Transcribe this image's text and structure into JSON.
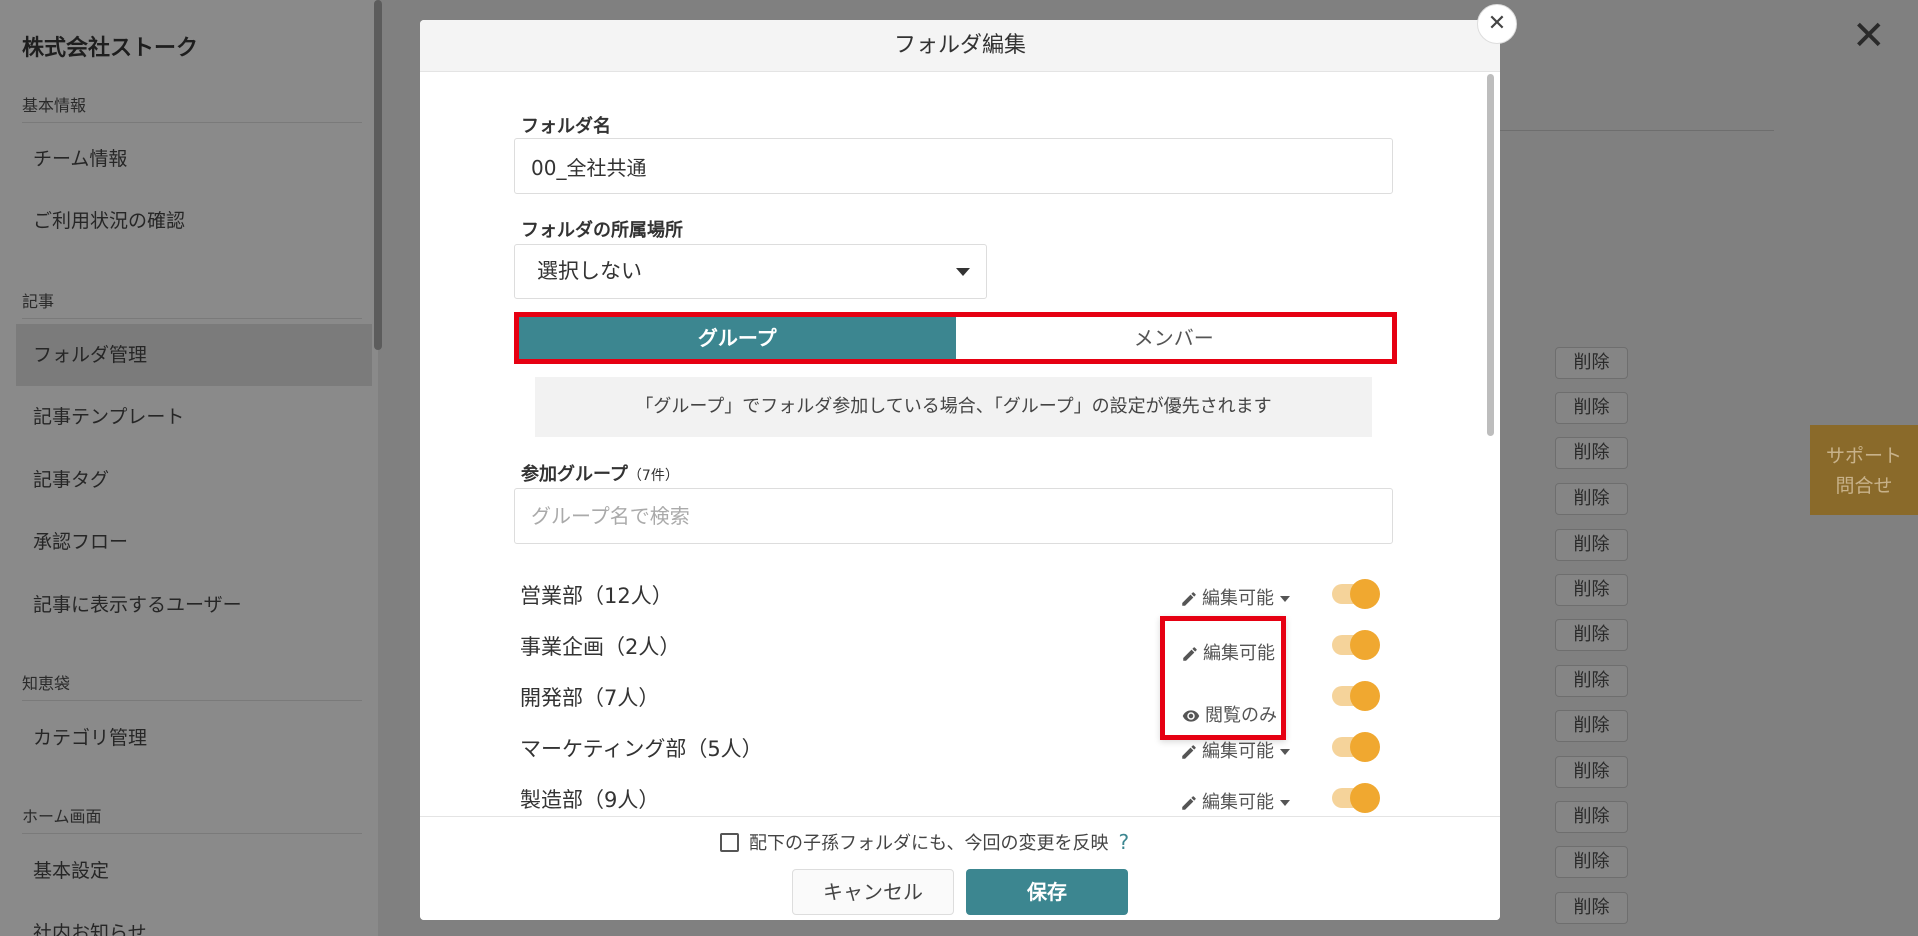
{
  "sidebar": {
    "company_name": "株式会社ストーク",
    "sections": [
      {
        "title": "基本情報",
        "items": [
          "チーム情報",
          "ご利用状況の確認"
        ]
      },
      {
        "title": "記事",
        "items": [
          "フォルダ管理",
          "記事テンプレート",
          "記事タグ",
          "承認フロー",
          "記事に表示するユーザー"
        ]
      },
      {
        "title": "知恵袋",
        "items": [
          "カテゴリ管理"
        ]
      },
      {
        "title": "ホーム画面",
        "items": [
          "基本設定",
          "社内お知らせ"
        ]
      }
    ],
    "active_item": "フォルダ管理"
  },
  "main": {
    "delete_label": "削除",
    "support_label_1": "サポート",
    "support_label_2": "問合せ"
  },
  "modal": {
    "title": "フォルダ編集",
    "folder_name_label": "フォルダ名",
    "folder_name_value": "00_全社共通",
    "location_label": "フォルダの所属場所",
    "location_value": "選択しない",
    "tabs": {
      "group": "グループ",
      "member": "メンバー"
    },
    "notice": "「グループ」でフォルダ参加している場合、「グループ」の設定が優先されます",
    "groups_label": "参加グループ",
    "groups_count": "（7件）",
    "search_placeholder": "グループ名で検索",
    "groups": [
      {
        "name": "営業部（12人）",
        "permission": "編集可能"
      },
      {
        "name": "事業企画（2人）",
        "permission": ""
      },
      {
        "name": "開発部（7人）",
        "permission": ""
      },
      {
        "name": "マーケティング部（5人）",
        "permission": "編集可能"
      },
      {
        "name": "製造部（9人）",
        "permission": "編集可能"
      }
    ],
    "dropdown": {
      "edit": "編集可能",
      "view": "閲覧のみ"
    },
    "apply_children_label": "配下の子孫フォルダにも、今回の変更を反映",
    "help_mark": "?",
    "cancel_label": "キャンセル",
    "save_label": "保存"
  },
  "colors": {
    "accent": "#3c8690",
    "highlight": "#e60012",
    "toggle": "#f0a830"
  }
}
